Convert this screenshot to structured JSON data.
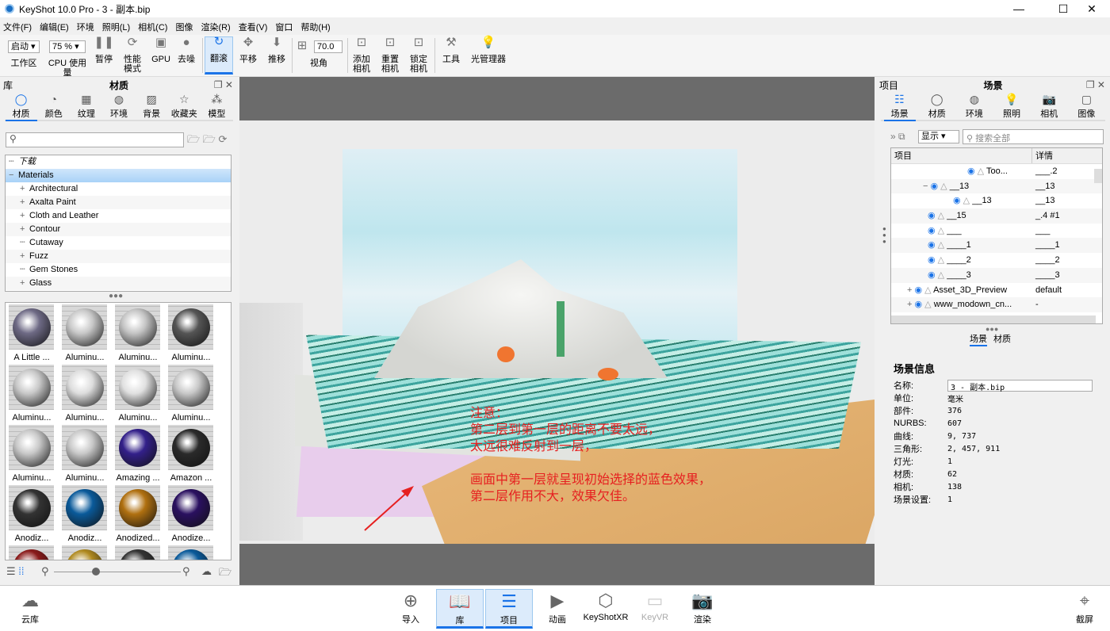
{
  "window": {
    "title": "KeyShot 10.0 Pro  - 3 - 副本.bip",
    "minimize": "—",
    "maximize": "☐",
    "close": "✕"
  },
  "menu": [
    "文件(F)",
    "编辑(E)",
    "环境",
    "照明(L)",
    "相机(C)",
    "图像",
    "渲染(R)",
    "查看(V)",
    "窗口",
    "帮助(H)"
  ],
  "toolbar": {
    "workspace_value": "启动",
    "workspace_label": "工作区",
    "cpu_value": "75 %",
    "cpu_label": "CPU 使用量",
    "pause": "暂停",
    "perf_mode": "性能\n模式",
    "gpu": "GPU",
    "denoise": "去噪",
    "tumble": "翻滚",
    "pan": "平移",
    "dolly": "推移",
    "fov_value": "70.0",
    "fov_label": "视角",
    "add_camera": "添加相机",
    "reset_camera": "重置相机",
    "lock_camera": "锁定相机",
    "tools": "工具",
    "light_manager": "光管理器"
  },
  "library": {
    "left": "库",
    "title": "材质",
    "tabs": [
      "材质",
      "颜色",
      "纹理",
      "环境",
      "背景",
      "收藏夹",
      "模型"
    ],
    "search_placeholder": "",
    "tree": [
      {
        "label": "下载",
        "italic": true,
        "expand": ""
      },
      {
        "label": "Materials",
        "expand": "−",
        "selected": true
      },
      {
        "label": "Architectural",
        "expand": "+"
      },
      {
        "label": "Axalta Paint",
        "expand": "+"
      },
      {
        "label": "Cloth and Leather",
        "expand": "+"
      },
      {
        "label": "Contour",
        "expand": "+"
      },
      {
        "label": "Cutaway",
        "expand": ""
      },
      {
        "label": "Fuzz",
        "expand": "+"
      },
      {
        "label": "Gem Stones",
        "expand": ""
      },
      {
        "label": "Glass",
        "expand": "+"
      }
    ],
    "materials": [
      {
        "name": "A Little ...",
        "color": "#6e6a85"
      },
      {
        "name": "Aluminu...",
        "color": "#c8c8c8"
      },
      {
        "name": "Aluminu...",
        "color": "#c4c4c4"
      },
      {
        "name": "Aluminu...",
        "color": "#555"
      },
      {
        "name": "Aluminu...",
        "color": "#c8c8c8"
      },
      {
        "name": "Aluminu...",
        "color": "#ddd"
      },
      {
        "name": "Aluminu...",
        "color": "#e0e0e0"
      },
      {
        "name": "Aluminu...",
        "color": "#c8c8c8"
      },
      {
        "name": "Aluminu...",
        "color": "#c8c8c8"
      },
      {
        "name": "Aluminu...",
        "color": "#c8c8c8"
      },
      {
        "name": "Amazing ...",
        "color": "#33208a"
      },
      {
        "name": "Amazon ...",
        "color": "#2a2a2a"
      },
      {
        "name": "Anodiz...",
        "color": "#333"
      },
      {
        "name": "Anodiz...",
        "color": "#0a5a9a"
      },
      {
        "name": "Anodized...",
        "color": "#b07010"
      },
      {
        "name": "Anodize...",
        "color": "#2a1060"
      },
      {
        "name": "",
        "color": "#8a1a1a"
      },
      {
        "name": "",
        "color": "#b08a20"
      },
      {
        "name": "",
        "color": "#333"
      },
      {
        "name": "",
        "color": "#0a5a9a"
      }
    ]
  },
  "viewport": {
    "annotation": [
      "注意：",
      "第二层到第一层的距离不要太远，",
      "太远很难反射到一层，",
      "",
      "画面中第一层就呈现初始选择的蓝色效果，",
      "第二层作用不大，效果欠佳。"
    ],
    "annotation_color": "#e62020"
  },
  "project": {
    "left": "项目",
    "title": "场景",
    "tabs": [
      "场景",
      "材质",
      "环境",
      "照明",
      "相机",
      "图像"
    ],
    "display": "显示",
    "search_placeholder": "搜索全部",
    "col_item": "项目",
    "col_detail": "详情",
    "rows": [
      {
        "indent": 96,
        "exp": "",
        "name": "Too...",
        "detail": "___.2"
      },
      {
        "indent": 40,
        "exp": "−",
        "name": "__13",
        "detail": "__13"
      },
      {
        "indent": 78,
        "exp": "",
        "name": "__13",
        "detail": "__13"
      },
      {
        "indent": 46,
        "exp": "",
        "name": "__15",
        "detail": "_.4 #1"
      },
      {
        "indent": 46,
        "exp": "",
        "name": "___",
        "detail": "___"
      },
      {
        "indent": 46,
        "exp": "",
        "name": "____1",
        "detail": "____1"
      },
      {
        "indent": 46,
        "exp": "",
        "name": "____2",
        "detail": "____2"
      },
      {
        "indent": 46,
        "exp": "",
        "name": "____3",
        "detail": "____3"
      },
      {
        "indent": 20,
        "exp": "+",
        "name": "Asset_3D_Preview",
        "detail": "default"
      },
      {
        "indent": 20,
        "exp": "+",
        "name": "www_modown_cn...",
        "detail": "-"
      }
    ],
    "subtabs": [
      "场景",
      "材质"
    ],
    "info_title": "场景信息",
    "name_label": "名称:",
    "name_value": "3 - 副本.bip",
    "info": [
      [
        "单位:",
        "毫米"
      ],
      [
        "部件:",
        "376"
      ],
      [
        "NURBS:",
        "607"
      ],
      [
        "曲线:",
        "9, 737"
      ],
      [
        "三角形:",
        "2, 457, 911"
      ],
      [
        "灯光:",
        "1"
      ],
      [
        "材质:",
        "62"
      ],
      [
        "相机:",
        "138"
      ],
      [
        "场景设置:",
        "1"
      ]
    ]
  },
  "bottom": {
    "cloud": "云库",
    "import": "导入",
    "library": "库",
    "project": "项目",
    "animation": "动画",
    "keyshotxr": "KeyShotXR",
    "keyvr": "KeyVR",
    "render": "渲染",
    "screenshot": "截屏"
  },
  "accent": "#1a73e8"
}
